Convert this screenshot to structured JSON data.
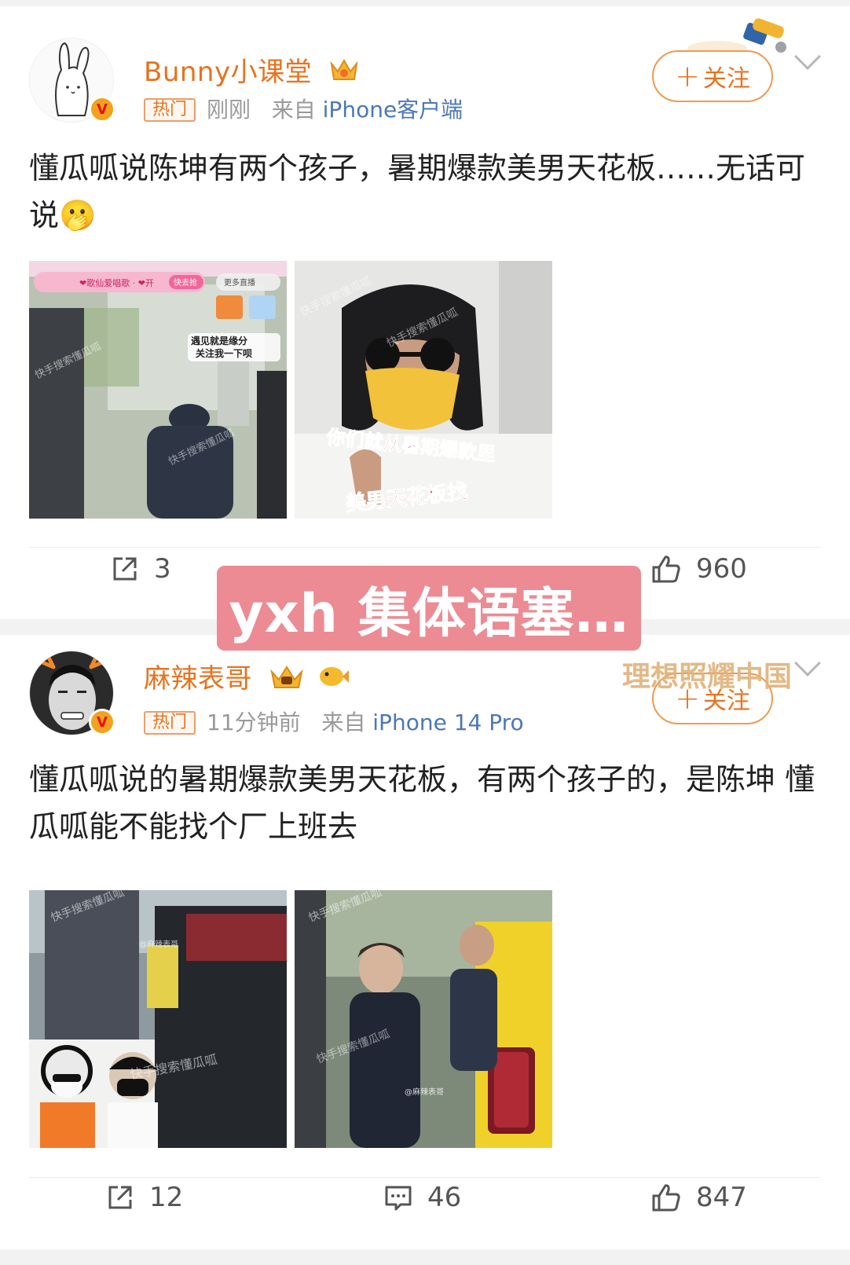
{
  "posts": [
    {
      "username": "Bunny小课堂",
      "hot_tag": "热门",
      "time": "刚刚",
      "source_prefix": "来自",
      "source": "iPhone客户端",
      "follow_label": "关注",
      "text": "懂瓜呱说陈坤有两个孩子，暑期爆款美男天花板……无话可说🫢",
      "images": [
        {
          "overlay_texts": [
            "歌仙爱唱歌",
            "开",
            "快去抢",
            "更多直播",
            "遇见就是缘分",
            "关注我一下呗",
            "快手搜索懂瓜呱"
          ]
        },
        {
          "overlay_texts": [
            "快手搜索懂瓜呱",
            "你们就从暑期爆款里",
            "美男天花板找"
          ]
        }
      ],
      "repost_count": "3",
      "like_count": "960"
    },
    {
      "username": "麻辣表哥",
      "hot_tag": "热门",
      "time": "11分钟前",
      "source_prefix": "来自",
      "source": "iPhone 14 Pro",
      "follow_label": "关注",
      "text": "懂瓜呱说的暑期爆款美男天花板，有两个孩子的，是陈坤  懂瓜呱能不能找个厂上班去",
      "images": [
        {
          "overlay_texts": [
            "快手搜索懂瓜呱",
            "@麻辣表哥"
          ]
        },
        {
          "overlay_texts": [
            "快手搜索懂瓜呱",
            "@麻辣表哥"
          ]
        }
      ],
      "repost_count": "12",
      "comment_count": "46",
      "like_count": "847"
    }
  ],
  "overlay_banner": "yxh 集体语塞…",
  "watermark": "理想照耀中国",
  "colors": {
    "username": "#e8721f",
    "source_link": "#4c78b6",
    "banner_bg": "#ec8b93",
    "follow_border": "#f09a50"
  }
}
